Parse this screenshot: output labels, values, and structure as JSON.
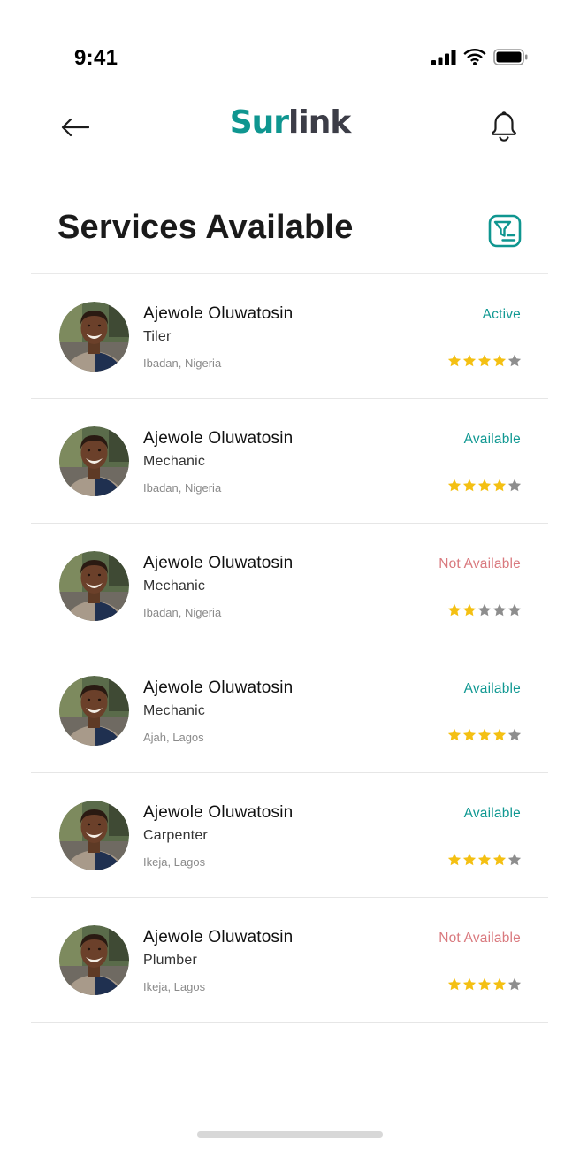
{
  "status_bar": {
    "time": "9:41"
  },
  "header": {
    "logo_part1": "Sur",
    "logo_part2": "link"
  },
  "page": {
    "title": "Services Available"
  },
  "colors": {
    "accent": "#0f9690",
    "available": "#109892",
    "unavailable": "#d9797e",
    "star_filled": "#f4c013",
    "star_empty": "#8e8e8e"
  },
  "rows": [
    {
      "name": "Ajewole Oluwatosin",
      "job": "Tiler",
      "location": "Ibadan, Nigeria",
      "status": "Active",
      "rating": 4
    },
    {
      "name": "Ajewole Oluwatosin",
      "job": "Mechanic",
      "location": "Ibadan, Nigeria",
      "status": "Available",
      "rating": 4
    },
    {
      "name": "Ajewole Oluwatosin",
      "job": "Mechanic",
      "location": "Ibadan, Nigeria",
      "status": "Not Available",
      "rating": 2
    },
    {
      "name": "Ajewole Oluwatosin",
      "job": "Mechanic",
      "location": "Ajah, Lagos",
      "status": "Available",
      "rating": 4
    },
    {
      "name": "Ajewole Oluwatosin",
      "job": "Carpenter",
      "location": "Ikeja, Lagos",
      "status": "Available",
      "rating": 4
    },
    {
      "name": "Ajewole Oluwatosin",
      "job": "Plumber",
      "location": "Ikeja, Lagos",
      "status": "Not Available",
      "rating": 4
    }
  ]
}
